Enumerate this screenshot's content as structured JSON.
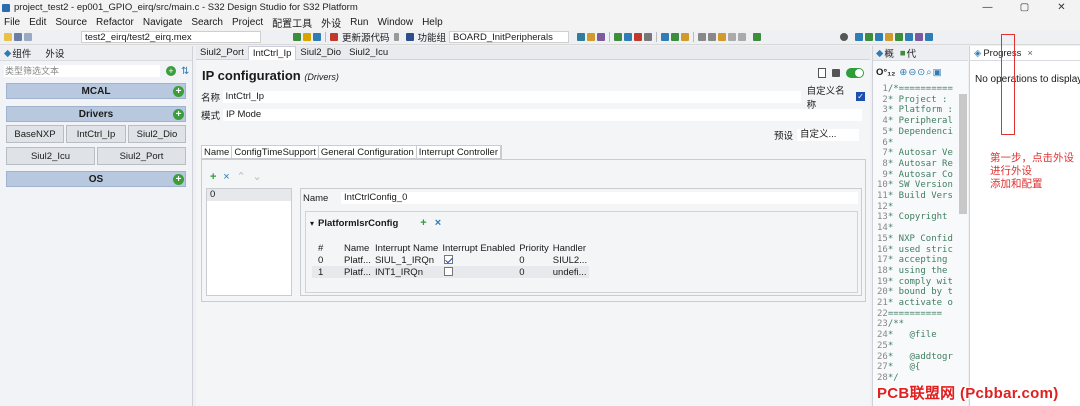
{
  "window": {
    "title": "project_test2 - ep001_GPIO_eirq/src/main.c - S32 Design Studio for S32 Platform",
    "controls": [
      "—",
      "▢",
      "✕"
    ]
  },
  "menu": [
    "File",
    "Edit",
    "Source",
    "Refactor",
    "Navigate",
    "Search",
    "Project",
    "配置工具",
    "外设",
    "Run",
    "Window",
    "Help"
  ],
  "toolbar": {
    "file_tab": "test2_eirq/test2_eirq.mex",
    "update_code": "更新源代码",
    "function_group_label": "功能组",
    "function_group_value": "BOARD_InitPeripherals"
  },
  "left_panel": {
    "tabs": [
      "组件",
      "外设"
    ],
    "filter_placeholder": "类型筛选文本",
    "groups": [
      {
        "label": "MCAL",
        "items": []
      },
      {
        "label": "Drivers",
        "items": [
          "BaseNXP",
          "IntCtrl_Ip",
          "Siul2_Dio",
          "Siul2_Icu",
          "Siul2_Port"
        ]
      },
      {
        "label": "OS",
        "items": []
      }
    ]
  },
  "editor": {
    "tabs": [
      "Siul2_Port",
      "IntCtrl_Ip",
      "Siul2_Dio",
      "Siul2_Icu"
    ],
    "active_tab": "IntCtrl_Ip",
    "heading": "IP configuration",
    "heading_sub": "(Drivers)",
    "name_label": "名称",
    "name_value": "IntCtrl_Ip",
    "custom_name_label": "自定义名称",
    "mode_label": "模式",
    "mode_value": "IP Mode",
    "preset_label": "预设",
    "preset_value": "自定义...",
    "config_tabs": [
      "Name",
      "ConfigTimeSupport",
      "General Configuration",
      "Interrupt Controller"
    ],
    "index_list": [
      "0"
    ],
    "field_name_label": "Name",
    "field_name_value": "IntCtrlConfig_0",
    "isr_section": "PlatformIsrConfig",
    "isr_columns": [
      "#",
      "Name",
      "Interrupt Name",
      "Interrupt Enabled",
      "Priority",
      "Handler"
    ],
    "isr_rows": [
      {
        "idx": "0",
        "name": "Platf...",
        "irq": "SIUL_1_IRQn",
        "enabled": true,
        "priority": "0",
        "handler": "SIUL2..."
      },
      {
        "idx": "1",
        "name": "Platf...",
        "irq": "INT1_IRQn",
        "enabled": false,
        "priority": "0",
        "handler": "undefi..."
      }
    ]
  },
  "outline": {
    "tabs": [
      "概",
      "代"
    ],
    "header": "O°₁₂",
    "lines": [
      {
        "n": "1",
        "t": "/*=========="
      },
      {
        "n": "2",
        "t": "* Project :"
      },
      {
        "n": "3",
        "t": "* Platform :"
      },
      {
        "n": "4",
        "t": "* Peripheral"
      },
      {
        "n": "5",
        "t": "* Dependenci"
      },
      {
        "n": "6",
        "t": "*"
      },
      {
        "n": "7",
        "t": "* Autosar Ve"
      },
      {
        "n": "8",
        "t": "* Autosar Re"
      },
      {
        "n": "9",
        "t": "* Autosar Co"
      },
      {
        "n": "10",
        "t": "* SW Version"
      },
      {
        "n": "11",
        "t": "* Build Vers"
      },
      {
        "n": "12",
        "t": "*"
      },
      {
        "n": "13",
        "t": "* Copyright"
      },
      {
        "n": "14",
        "t": "*"
      },
      {
        "n": "15",
        "t": "* NXP Confid"
      },
      {
        "n": "16",
        "t": "* used stric"
      },
      {
        "n": "17",
        "t": "* accepting"
      },
      {
        "n": "18",
        "t": "* using the"
      },
      {
        "n": "19",
        "t": "* comply wit"
      },
      {
        "n": "20",
        "t": "* bound by t"
      },
      {
        "n": "21",
        "t": "* activate o"
      },
      {
        "n": "22",
        "t": "=========="
      },
      {
        "n": "23",
        "t": "/**"
      },
      {
        "n": "24",
        "t": "*   @file"
      },
      {
        "n": "25",
        "t": "*"
      },
      {
        "n": "26",
        "t": "*   @addtogr"
      },
      {
        "n": "27",
        "t": "*   @{"
      },
      {
        "n": "28",
        "t": "*/"
      }
    ]
  },
  "progress": {
    "tab": "Progress",
    "message": "No operations to display a"
  },
  "annotation": {
    "lines": [
      "第一步，点击外设",
      "进行外设",
      "添加和配置"
    ]
  },
  "watermark": "PCB联盟网 (Pcbbar.com)",
  "colors": {
    "group_header": "#b8c9df",
    "add_button": "#3a9e3a",
    "annotation": "#e03030"
  }
}
